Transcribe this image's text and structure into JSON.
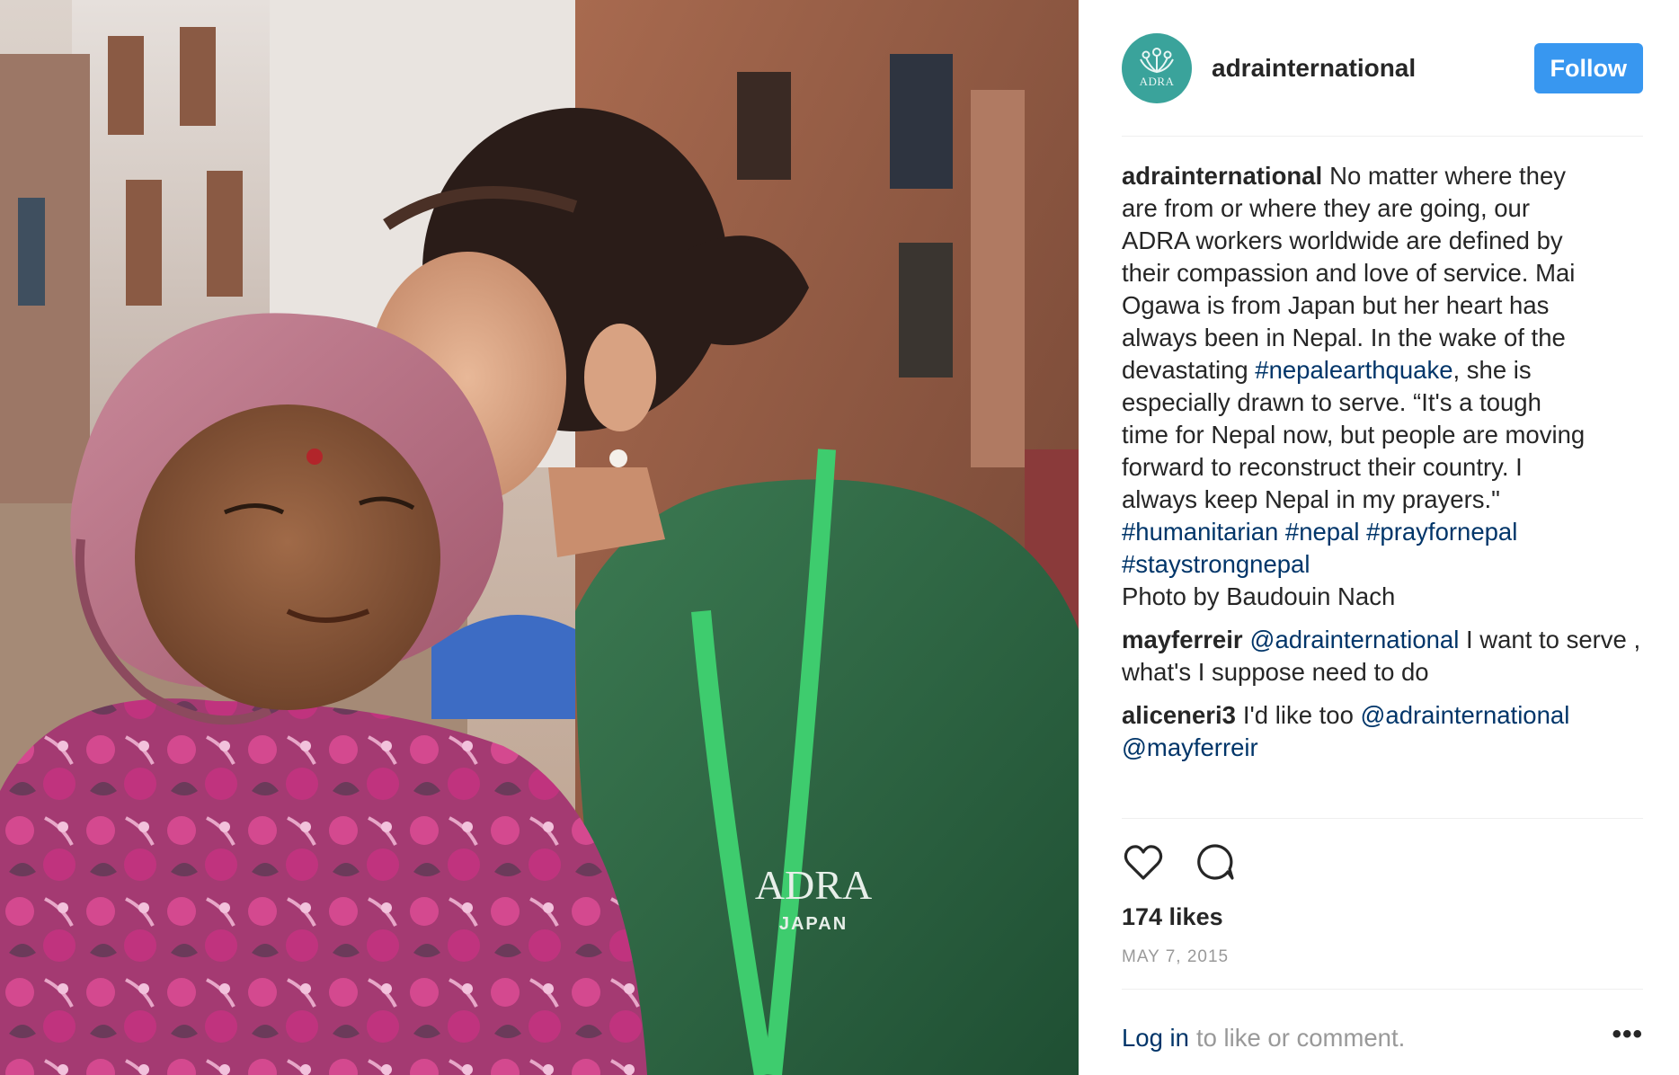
{
  "post": {
    "username": "adrainternational",
    "follow_label": "Follow",
    "avatar_text": "ADRA",
    "caption": {
      "user": "adrainternational",
      "lines": [
        "No matter where they",
        "are from or where they are going, our",
        "ADRA workers worldwide are defined by",
        "their compassion and love of service. Mai",
        "Ogawa is from Japan but her heart has",
        "always been in Nepal. In the wake of the"
      ],
      "line7_pre": "devastating ",
      "line7_tag": "#nepalearthquake",
      "line7_post": ", she is",
      "lines_b": [
        "especially drawn to serve. “It's a tough",
        "time for Nepal now, but people are moving",
        "forward to reconstruct their country. I",
        "always keep Nepal in my prayers.\""
      ],
      "hashtags_line1": "#humanitarian #nepal #prayfornepal",
      "hashtags_line2": "#staystrongnepal",
      "credit": "Photo by Baudouin Nach"
    },
    "comments": [
      {
        "user": "mayferreir",
        "mention": "@adrainternational",
        "text": " I want to serve , what's I suppose need to do"
      },
      {
        "user": "aliceneri3",
        "text": "I'd like too ",
        "mention": "@adrainternational",
        "mention2": "@mayferreir"
      }
    ],
    "likes": "174 likes",
    "date": "MAY 7, 2015",
    "login_link": "Log in",
    "login_rest": "to like or comment.",
    "more_label": "•••",
    "photo_text": {
      "shirt_brand": "ADRA",
      "shirt_sub": "JAPAN"
    }
  },
  "icons": {
    "like": "heart-outline-icon",
    "comment": "speech-bubble-icon",
    "more": "more-dots-icon"
  },
  "colors": {
    "follow": "#3897f0",
    "link": "#003569",
    "muted": "#999999",
    "avatar": "#3aa39b"
  }
}
